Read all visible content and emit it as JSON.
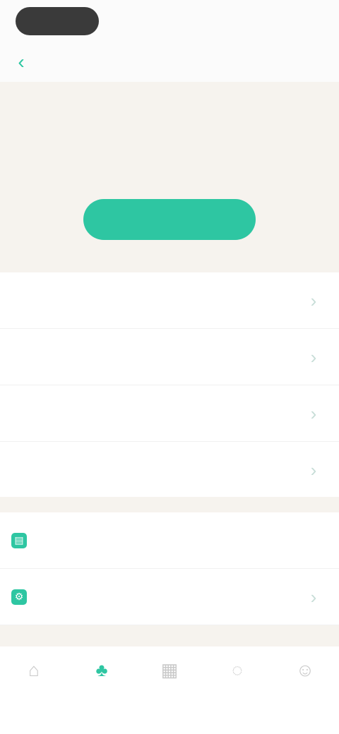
{
  "status_bar": {
    "time": ""
  },
  "nav": {
    "title": ""
  },
  "hero": {
    "title": "",
    "text": "",
    "button_label": ""
  },
  "menu": {
    "items": [
      {
        "label": "",
        "icon": "chevron-right-icon"
      },
      {
        "label": "",
        "icon": "chevron-right-icon"
      },
      {
        "label": "",
        "icon": "chevron-right-icon"
      },
      {
        "label": "",
        "icon": "chevron-right-icon"
      }
    ]
  },
  "menu2": {
    "items": [
      {
        "label": "",
        "icon": "document-icon"
      },
      {
        "label": "",
        "icon": "settings-icon"
      }
    ]
  },
  "tabs": [
    {
      "label": "",
      "icon": "home-icon",
      "active": false
    },
    {
      "label": "",
      "icon": "sprout-icon",
      "active": true
    },
    {
      "label": "",
      "icon": "calendar-icon",
      "active": false
    },
    {
      "label": "",
      "icon": "chat-icon",
      "active": false
    },
    {
      "label": "",
      "icon": "profile-icon",
      "active": false
    }
  ],
  "colors": {
    "accent": "#2ec6a2",
    "hero_bg": "#f6f3ee",
    "link_text": "#2aa98c"
  }
}
